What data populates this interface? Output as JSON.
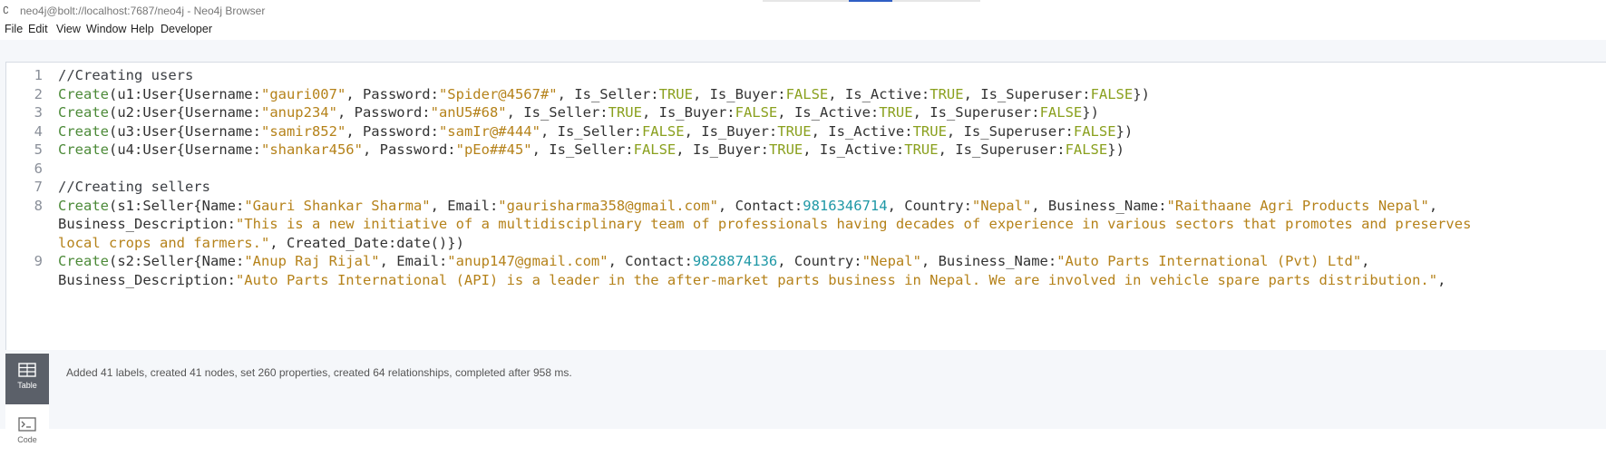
{
  "window": {
    "title": "neo4j@bolt://localhost:7687/neo4j - Neo4j Browser"
  },
  "menu": {
    "items": [
      "File",
      "Edit",
      "View",
      "Window",
      "Help",
      "Developer"
    ]
  },
  "editor": {
    "lines": [
      {
        "number": "1",
        "tokens": [
          {
            "t": "//Creating users",
            "c": "cmt"
          }
        ]
      },
      {
        "number": "2",
        "tokens": [
          {
            "t": "Create",
            "c": "kw"
          },
          {
            "t": "(u1:User{Username:"
          },
          {
            "t": "\"gauri007\"",
            "c": "str"
          },
          {
            "t": ", Password:"
          },
          {
            "t": "\"Spider@4567#\"",
            "c": "str"
          },
          {
            "t": ", Is_Seller:"
          },
          {
            "t": "TRUE",
            "c": "bool"
          },
          {
            "t": ", Is_Buyer:"
          },
          {
            "t": "FALSE",
            "c": "bool"
          },
          {
            "t": ", Is_Active:"
          },
          {
            "t": "TRUE",
            "c": "bool"
          },
          {
            "t": ", Is_Superuser:"
          },
          {
            "t": "FALSE",
            "c": "bool"
          },
          {
            "t": "})"
          }
        ]
      },
      {
        "number": "3",
        "tokens": [
          {
            "t": "Create",
            "c": "kw"
          },
          {
            "t": "(u2:User{Username:"
          },
          {
            "t": "\"anup234\"",
            "c": "str"
          },
          {
            "t": ", Password:"
          },
          {
            "t": "\"anU5#68\"",
            "c": "str"
          },
          {
            "t": ", Is_Seller:"
          },
          {
            "t": "TRUE",
            "c": "bool"
          },
          {
            "t": ", Is_Buyer:"
          },
          {
            "t": "FALSE",
            "c": "bool"
          },
          {
            "t": ", Is_Active:"
          },
          {
            "t": "TRUE",
            "c": "bool"
          },
          {
            "t": ", Is_Superuser:"
          },
          {
            "t": "FALSE",
            "c": "bool"
          },
          {
            "t": "})"
          }
        ]
      },
      {
        "number": "4",
        "tokens": [
          {
            "t": "Create",
            "c": "kw"
          },
          {
            "t": "(u3:User{Username:"
          },
          {
            "t": "\"samir852\"",
            "c": "str"
          },
          {
            "t": ", Password:"
          },
          {
            "t": "\"samIr@#444\"",
            "c": "str"
          },
          {
            "t": ", Is_Seller:"
          },
          {
            "t": "FALSE",
            "c": "bool"
          },
          {
            "t": ", Is_Buyer:"
          },
          {
            "t": "TRUE",
            "c": "bool"
          },
          {
            "t": ", Is_Active:"
          },
          {
            "t": "TRUE",
            "c": "bool"
          },
          {
            "t": ", Is_Superuser:"
          },
          {
            "t": "FALSE",
            "c": "bool"
          },
          {
            "t": "})"
          }
        ]
      },
      {
        "number": "5",
        "tokens": [
          {
            "t": "Create",
            "c": "kw"
          },
          {
            "t": "(u4:User{Username:"
          },
          {
            "t": "\"shankar456\"",
            "c": "str"
          },
          {
            "t": ", Password:"
          },
          {
            "t": "\"pEo##45\"",
            "c": "str"
          },
          {
            "t": ", Is_Seller:"
          },
          {
            "t": "FALSE",
            "c": "bool"
          },
          {
            "t": ", Is_Buyer:"
          },
          {
            "t": "TRUE",
            "c": "bool"
          },
          {
            "t": ", Is_Active:"
          },
          {
            "t": "TRUE",
            "c": "bool"
          },
          {
            "t": ", Is_Superuser:"
          },
          {
            "t": "FALSE",
            "c": "bool"
          },
          {
            "t": "})"
          }
        ]
      },
      {
        "number": "6",
        "tokens": []
      },
      {
        "number": "7",
        "tokens": [
          {
            "t": "//Creating sellers",
            "c": "cmt"
          }
        ]
      },
      {
        "number": "8",
        "tokens": [
          {
            "t": "Create",
            "c": "kw"
          },
          {
            "t": "(s1:Seller{Name:"
          },
          {
            "t": "\"Gauri Shankar Sharma\"",
            "c": "str"
          },
          {
            "t": ", Email:"
          },
          {
            "t": "\"gaurisharma358@gmail.com\"",
            "c": "str"
          },
          {
            "t": ", Contact:"
          },
          {
            "t": "9816346714",
            "c": "num"
          },
          {
            "t": ", Country:"
          },
          {
            "t": "\"Nepal\"",
            "c": "str"
          },
          {
            "t": ", Business_Name:"
          },
          {
            "t": "\"Raithaane Agri Products Nepal\"",
            "c": "str"
          },
          {
            "t": ","
          }
        ]
      },
      {
        "number": "",
        "tokens": [
          {
            "t": "Business_Description:"
          },
          {
            "t": "\"This is a new initiative of a multidisciplinary team of professionals having decades of experience in various sectors that promotes and preserves",
            "c": "str"
          }
        ]
      },
      {
        "number": "",
        "tokens": [
          {
            "t": "local crops and farmers.\"",
            "c": "str"
          },
          {
            "t": ", Created_Date:date()})"
          }
        ]
      },
      {
        "number": "9",
        "tokens": [
          {
            "t": "Create",
            "c": "kw"
          },
          {
            "t": "(s2:Seller{Name:"
          },
          {
            "t": "\"Anup Raj Rijal\"",
            "c": "str"
          },
          {
            "t": ", Email:"
          },
          {
            "t": "\"anup147@gmail.com\"",
            "c": "str"
          },
          {
            "t": ", Contact:"
          },
          {
            "t": "9828874136",
            "c": "num"
          },
          {
            "t": ", Country:"
          },
          {
            "t": "\"Nepal\"",
            "c": "str"
          },
          {
            "t": ", Business_Name:"
          },
          {
            "t": "\"Auto Parts International (Pvt) Ltd\"",
            "c": "str"
          },
          {
            "t": ","
          }
        ]
      },
      {
        "number": "",
        "tokens": [
          {
            "t": "Business_Description:"
          },
          {
            "t": "\"Auto Parts International (API) is a leader in the after-market parts business in Nepal. We are involved in vehicle spare parts distribution.\"",
            "c": "str"
          },
          {
            "t": ","
          }
        ]
      }
    ]
  },
  "result": {
    "tabs": [
      {
        "label": "Table",
        "icon": "table-icon",
        "active": true
      },
      {
        "label": "Code",
        "icon": "code-icon",
        "active": false
      }
    ],
    "message": "Added 41 labels, created 41 nodes, set 260 properties, created 64 relationships, completed after 958 ms."
  }
}
